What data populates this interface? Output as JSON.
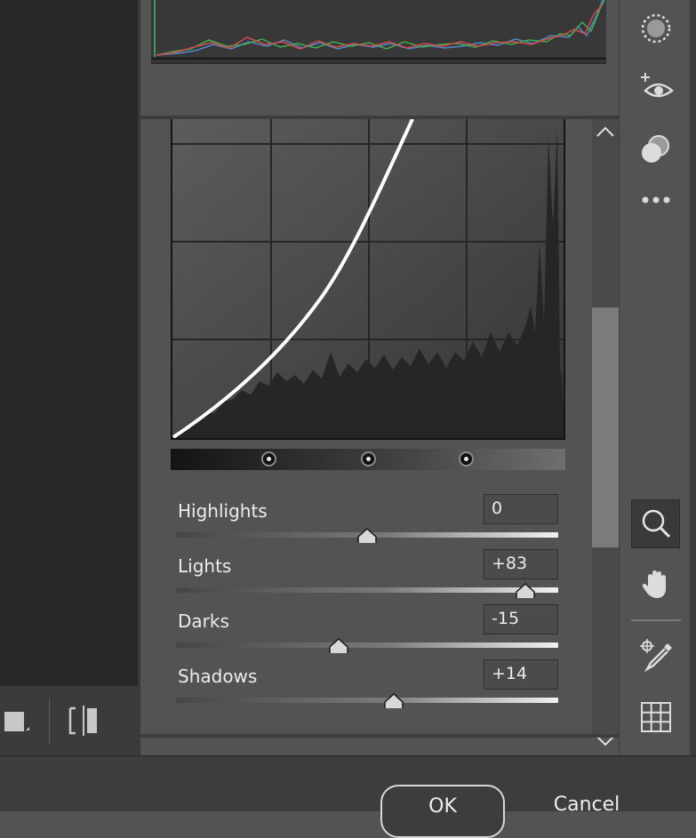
{
  "sliders": [
    {
      "id": "highlights",
      "label": "Highlights",
      "value": "0",
      "level": 0.5
    },
    {
      "id": "lights",
      "label": "Lights",
      "value": "+83",
      "level": 0.915
    },
    {
      "id": "darks",
      "label": "Darks",
      "value": "-15",
      "level": 0.425
    },
    {
      "id": "shadows",
      "label": "Shadows",
      "value": "+14",
      "level": 0.57
    }
  ],
  "region_split_handles": 3,
  "buttons": {
    "ok": "OK",
    "cancel": "Cancel"
  },
  "tools": [
    "radial-mask-icon",
    "red-eye-icon",
    "mask-overlay-icon",
    "more-options-icon",
    "zoom-icon",
    "hand-icon",
    "color-sampler-icon",
    "grid-icon"
  ],
  "colors": {
    "panel_bg": "#535353",
    "curve": "#ffffff",
    "footer": "#3d3d3d"
  }
}
